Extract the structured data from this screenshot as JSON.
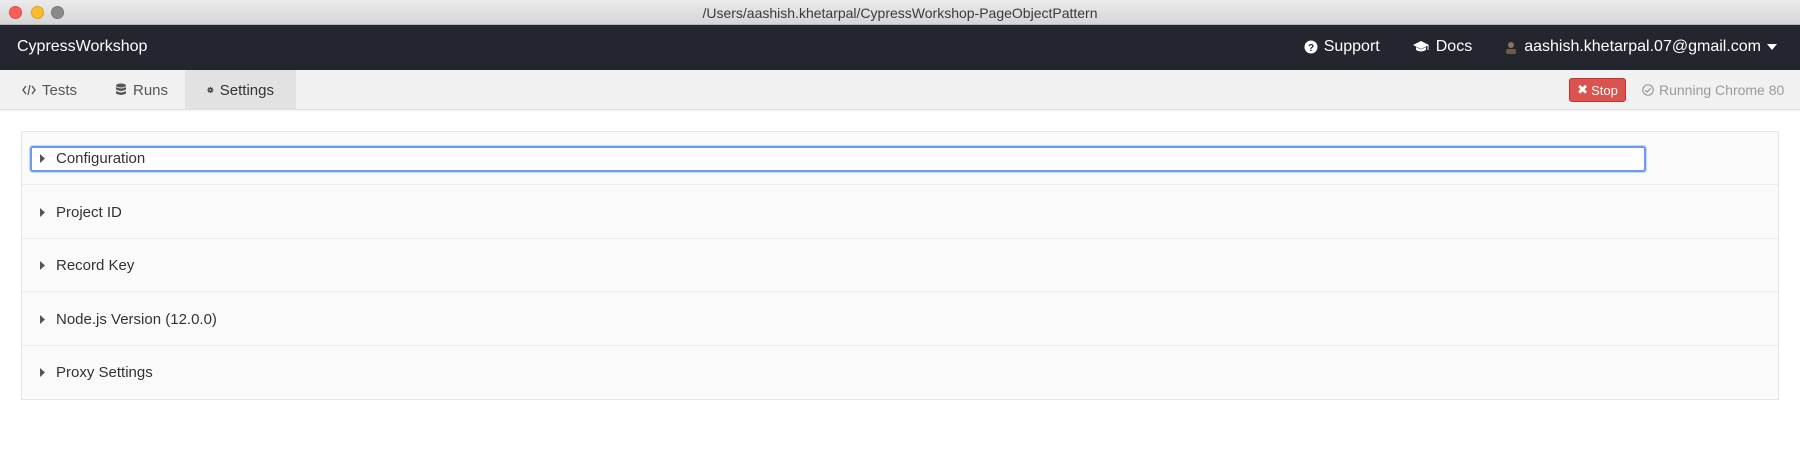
{
  "window": {
    "title": "/Users/aashish.khetarpal/CypressWorkshop-PageObjectPattern"
  },
  "header": {
    "brand": "CypressWorkshop",
    "support_label": "Support",
    "docs_label": "Docs",
    "user_email": "aashish.khetarpal.07@gmail.com"
  },
  "nav": {
    "tabs": [
      {
        "label": "Tests",
        "icon": "code-icon"
      },
      {
        "label": "Runs",
        "icon": "database-icon"
      },
      {
        "label": "Settings",
        "icon": "gear-icon",
        "active": true
      }
    ],
    "stop_label": "Stop",
    "running_label": "Running Chrome 80"
  },
  "settings": {
    "sections": [
      {
        "label": "Configuration",
        "focused": true
      },
      {
        "label": "Project ID"
      },
      {
        "label": "Record Key"
      },
      {
        "label": "Node.js Version (12.0.0)"
      },
      {
        "label": "Proxy Settings"
      }
    ]
  },
  "colors": {
    "header_bg": "#23252f",
    "stop_button": "#d9534f",
    "focus_ring": "#6b9aee"
  }
}
